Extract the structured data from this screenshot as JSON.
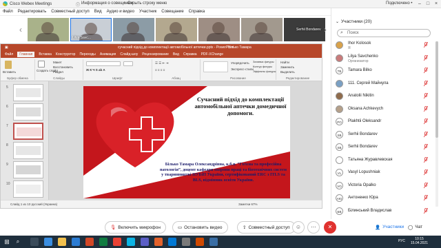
{
  "window": {
    "app_title": "Cisco Webex Meetings",
    "info_label": "Информация о совещании",
    "hide_label": "Скрыть строку меню",
    "connected_label": "Подключено •"
  },
  "menubar": [
    "Файл",
    "Редактировать",
    "Совместный доступ",
    "Вид",
    "Аудио и видео",
    "Участник",
    "Совещание",
    "Справка"
  ],
  "video_tiles": [
    {
      "name": "",
      "color": "#a9b28a"
    },
    {
      "name": "Lilya Savc...",
      "color": "#c9cfd6"
    },
    {
      "name": "",
      "color": "#8c9ca6"
    },
    {
      "name": "",
      "color": "#b3a88f"
    },
    {
      "name": "",
      "color": "#9e8e84"
    },
    {
      "name": "",
      "color": "#a2998e"
    },
    {
      "name": "Serhii Bondarev",
      "color": "#3b3b3b"
    }
  ],
  "ppt": {
    "title": "сучасний підхід до комплектації автомобільної аптечки.pptx - PowerPoint",
    "user": "Білько Тамара",
    "tabs": [
      "Файл",
      "Главная",
      "Вставка",
      "Конструктор",
      "Переходы",
      "Анимация",
      "Слайд-шоу",
      "Рецензирование",
      "Вид",
      "Справка",
      "PDF-XChange"
    ],
    "active_tab": "Главная",
    "ribbon_groups": [
      "Буфер обмена",
      "Слайды",
      "Шрифт",
      "Абзац",
      "Рисование",
      "Редактирование"
    ],
    "ribbon_texts": {
      "paste": "Вставить",
      "create_slide": "Создать слайд",
      "layout": "Макет",
      "reset": "Восстановить",
      "section": "Раздел",
      "find": "Найти",
      "replace": "Заменить",
      "select": "Выделить",
      "fill": "Заливка фигуры",
      "outline": "Контур фигуры",
      "effects": "Эффекты фигуры",
      "arrange": "Упорядочить",
      "styles": "Экспресс-стили"
    },
    "thumb_numbers": [
      "5",
      "6",
      "7",
      "8",
      "9",
      "10"
    ],
    "status_left": "Слайд 1 из 10    русский (Украина)",
    "status_right": "Заметки        67%"
  },
  "slide": {
    "title": "Сучасний підхід до комплектації автомобільної аптечки домедичної допомоги.",
    "author": "Білько Тамара Олександрівна, к.б.н. “Гігієна та професійна патологія”, доцент кафедри охорони праці та біотехнічних систем у тваринництві НУБіП України, сертифікований ERC з ITLS та BLS, відмінник освіти України.",
    "heart_color": "#d92128",
    "band_color": "#c4161c"
  },
  "participants": {
    "header": "Участники (20)",
    "search_placeholder": "Поиск",
    "list": [
      {
        "name": "Ihor Kolosok",
        "role": "Я",
        "initials": ""
      },
      {
        "name": "Lilya Savchenko",
        "role": "Организатор",
        "initials": ""
      },
      {
        "name": "Tamara Bilko",
        "role": "",
        "initials": "TB"
      },
      {
        "name": "111. Сергей Майнула",
        "role": "",
        "initials": ""
      },
      {
        "name": "Anatolii Nikitin",
        "role": "",
        "initials": ""
      },
      {
        "name": "Oksana Achkevych",
        "role": "",
        "initials": ""
      },
      {
        "name": "Plakhtii Oleksandr",
        "role": "",
        "initials": "PO"
      },
      {
        "name": "Serhii Bondarev",
        "role": "",
        "initials": "SB"
      },
      {
        "name": "Serhii Bondarev",
        "role": "",
        "initials": "SB"
      },
      {
        "name": "Татьяна Журавлевская",
        "role": "",
        "initials": ""
      },
      {
        "name": "Vasyl Lopushniak",
        "role": "",
        "initials": "VL"
      },
      {
        "name": "Victoria Opalko",
        "role": "",
        "initials": "VO"
      },
      {
        "name": "Антоненко Юра",
        "role": "",
        "initials": "AЮ"
      },
      {
        "name": "Білинський Владислав",
        "role": "",
        "initials": "БВ"
      }
    ]
  },
  "controls": {
    "mic": "Включить микрофон",
    "video": "Остановить видео",
    "share": "Совместный доступ",
    "participants": "Участники",
    "chat": "Чат"
  },
  "taskbar": {
    "lang": "РУС",
    "time": "10:15",
    "date": "15.04.2021"
  }
}
